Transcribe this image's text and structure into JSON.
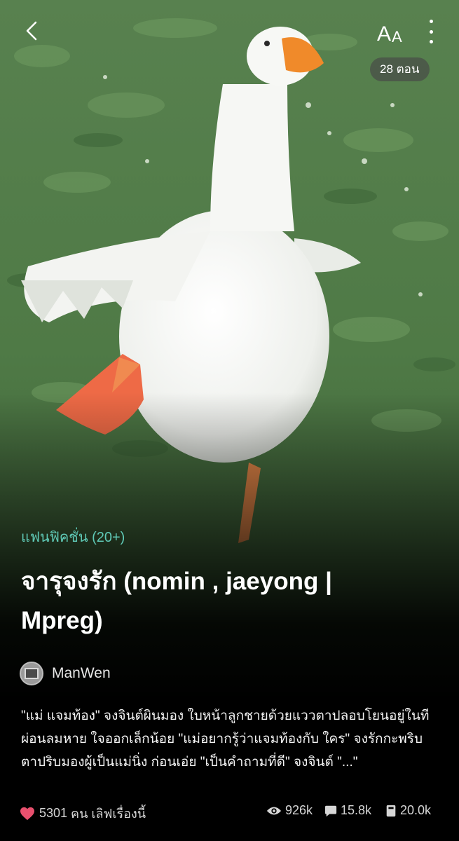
{
  "top_bar": {
    "font_button": {
      "big": "A",
      "small": "A"
    },
    "episodes_badge": "28 ตอน"
  },
  "story": {
    "genre": "แฟนฟิคชั่น (20+)",
    "title": "จารุจงรัก (nomin , jaeyong | Mpreg)",
    "author": "ManWen",
    "synopsis": "\"แม่ แจมท้อง\" จงจินต์ผินมอง ใบหน้าลูกชายด้วยแววตาปลอบโยนอยู่ในที ผ่อนลมหาย ใจออกเล็กน้อย \"แม่อยากรู้ว่าแจมท้องกับ ใคร\" จงรักกะพริบตาปริบมองผู้เป็นแม่นิ่ง ก่อนเอ่ย \"เป็นคำถามที่ดี\" จงจินต์ \"...\""
  },
  "stats": {
    "likes_count": "5301",
    "likes_text": "คน เลิฟเรื่องนี้",
    "views": "926k",
    "comments": "15.8k",
    "saves": "20.0k"
  },
  "colors": {
    "genre": "#5fc9b6",
    "heart": "#e8506e",
    "background": "#000000"
  },
  "icons": [
    "back-chevron-icon",
    "more-vertical-icon",
    "heart-icon",
    "eye-icon",
    "comment-icon",
    "bookmark-icon"
  ]
}
